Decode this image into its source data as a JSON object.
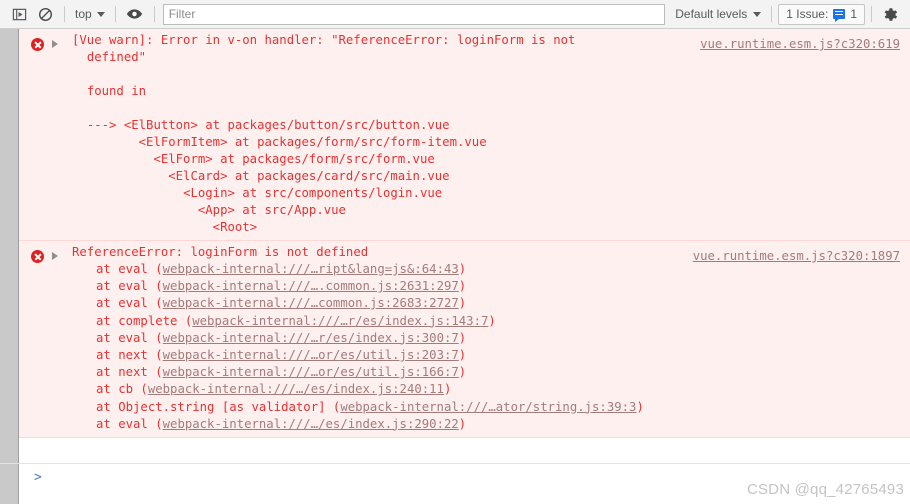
{
  "toolbar": {
    "icons": {
      "sidebar_toggle": "console-sidebar-icon",
      "clear": "clear-console-icon",
      "eye": "eye-icon",
      "gear": "gear-icon"
    },
    "context_label": "top",
    "filter_placeholder": "Filter",
    "filter_value": "",
    "levels_label": "Default levels",
    "issues_label": "1 Issue:",
    "issues_count": "1",
    "issues_accent": "#1a73e8"
  },
  "console": {
    "messages": [
      {
        "level": "error",
        "icon": "error-circle-icon",
        "expander": "expand-triangle-icon",
        "text": "[Vue warn]: Error in v-on handler: \"ReferenceError: loginForm is not\n  defined\"\n\n  found in\n\n  ---> <ElButton> at packages/button/src/button.vue\n         <ElFormItem> at packages/form/src/form-item.vue\n           <ElForm> at packages/form/src/form.vue\n             <ElCard> at packages/card/src/main.vue\n               <Login> at src/components/login.vue\n                 <App> at src/App.vue\n                   <Root>",
        "source": "vue.runtime.esm.js?c320:619"
      },
      {
        "level": "error",
        "icon": "error-circle-icon",
        "expander": "expand-triangle-icon",
        "text": "ReferenceError: loginForm is not defined",
        "source": "vue.runtime.esm.js?c320:1897",
        "stack": [
          {
            "fn": "at eval (",
            "link": "webpack-internal:///…ript&lang=js&:64:43",
            "tail": ")"
          },
          {
            "fn": "at eval (",
            "link": "webpack-internal:///….common.js:2631:297",
            "tail": ")"
          },
          {
            "fn": "at eval (",
            "link": "webpack-internal:///…common.js:2683:2727",
            "tail": ")"
          },
          {
            "fn": "at complete (",
            "link": "webpack-internal:///…r/es/index.js:143:7",
            "tail": ")"
          },
          {
            "fn": "at eval (",
            "link": "webpack-internal:///…r/es/index.js:300:7",
            "tail": ")"
          },
          {
            "fn": "at next (",
            "link": "webpack-internal:///…or/es/util.js:203:7",
            "tail": ")"
          },
          {
            "fn": "at next (",
            "link": "webpack-internal:///…or/es/util.js:166:7",
            "tail": ")"
          },
          {
            "fn": "at cb (",
            "link": "webpack-internal:///…/es/index.js:240:11",
            "tail": ")"
          },
          {
            "fn": "at Object.string [as validator] (",
            "link": "webpack-internal:///…ator/string.js:39:3",
            "tail": ")"
          },
          {
            "fn": "at eval (",
            "link": "webpack-internal:///…/es/index.js:290:22",
            "tail": ")"
          }
        ]
      }
    ]
  },
  "prompt": {
    "caret": ">",
    "value": ""
  },
  "watermark": "CSDN @qq_42765493"
}
